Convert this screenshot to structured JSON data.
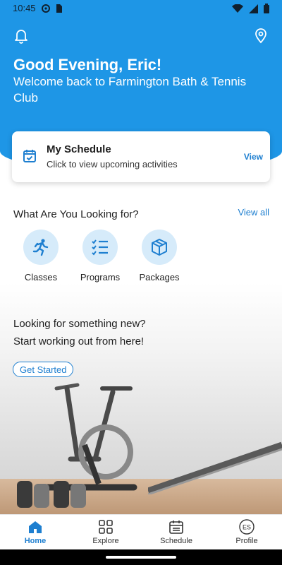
{
  "status_bar": {
    "time": "10:45"
  },
  "hero": {
    "greeting": "Good Evening, Eric!",
    "welcome": "Welcome back to Farmington Bath & Tennis Club",
    "icons": [
      "bell-icon",
      "location-pin-icon"
    ]
  },
  "schedule_card": {
    "title": "My Schedule",
    "subtitle": "Click to view upcoming activities",
    "action": "View"
  },
  "categories": {
    "title": "What Are You Looking for?",
    "view_all": "View all",
    "items": [
      {
        "label": "Classes",
        "icon": "running-person-icon"
      },
      {
        "label": "Programs",
        "icon": "checklist-icon"
      },
      {
        "label": "Packages",
        "icon": "package-box-icon"
      }
    ]
  },
  "promo": {
    "line1": "Looking for something new?",
    "line2": "Start working out from here!",
    "button": "Get Started"
  },
  "bottom_nav": {
    "items": [
      {
        "label": "Home",
        "icon": "home-icon",
        "active": true
      },
      {
        "label": "Explore",
        "icon": "grid-icon"
      },
      {
        "label": "Schedule",
        "icon": "calendar-icon"
      },
      {
        "label": "Profile",
        "icon": "profile-initials-icon",
        "initials": "ES"
      }
    ]
  },
  "colors": {
    "primary": "#1e96e6",
    "accent": "#1e7fd0",
    "icon_bg": "#d6ebfa"
  }
}
